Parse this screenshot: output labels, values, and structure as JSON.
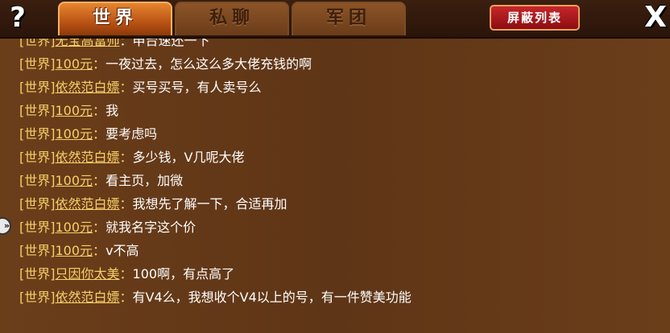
{
  "topbar": {
    "help_label": "?",
    "tabs": [
      {
        "label": "世界",
        "active": true
      },
      {
        "label": "私聊",
        "active": false
      },
      {
        "label": "军团",
        "active": false
      }
    ],
    "block_list_label": "屏蔽列表",
    "close_label": "X"
  },
  "chat": {
    "partial_line": {
      "channel": "[世界]",
      "sender": "无宝高富帅",
      "content": "：申台速还一下"
    },
    "messages": [
      {
        "channel": "[世界]",
        "sender": "100元",
        "content": "一夜过去，怎么这么多大佬充钱的啊"
      },
      {
        "channel": "[世界]",
        "sender": "依然范白嫖",
        "content": "买号买号，有人卖号么"
      },
      {
        "channel": "[世界]",
        "sender": "100元",
        "content": "我"
      },
      {
        "channel": "[世界]",
        "sender": "100元",
        "content": "要考虑吗"
      },
      {
        "channel": "[世界]",
        "sender": "依然范白嫖",
        "content": "多少钱，V几呢大佬"
      },
      {
        "channel": "[世界]",
        "sender": "100元",
        "content": "看主页，加微"
      },
      {
        "channel": "[世界]",
        "sender": "依然范白嫖",
        "content": "我想先了解一下，合适再加"
      },
      {
        "channel": "[世界]",
        "sender": "100元",
        "content": "就我名字这个价"
      },
      {
        "channel": "[世界]",
        "sender": "100元",
        "content": "v不高"
      },
      {
        "channel": "[世界]",
        "sender": "只因你太美",
        "content": "100啊，有点高了"
      },
      {
        "channel": "[世界]",
        "sender": "依然范白嫖",
        "content": "有V4么，我想收个V4以上的号，有一件赞美功能"
      }
    ],
    "colon": "："
  },
  "colors": {
    "channel_text": "#f7cf68",
    "message_text": "#ffffff",
    "active_tab": "#d06a20",
    "block_button": "#b01a1e"
  }
}
